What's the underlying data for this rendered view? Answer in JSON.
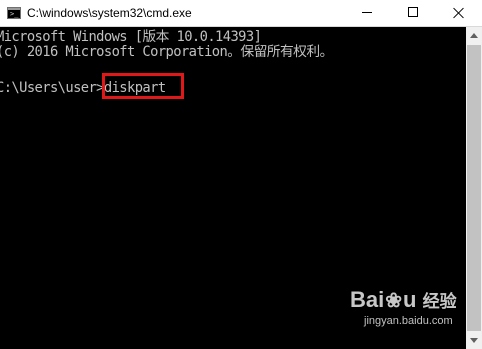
{
  "window": {
    "title": "C:\\windows\\system32\\cmd.exe",
    "buttons": {
      "minimize": "minimize-icon",
      "maximize": "maximize-icon",
      "close": "close-icon"
    }
  },
  "console": {
    "lines": [
      "Microsoft Windows [版本 10.0.14393]",
      "(c) 2016 Microsoft Corporation。保留所有权利。"
    ],
    "prompt": "C:\\Users\\user>",
    "command": "diskpart"
  },
  "highlight": {
    "color": "#e01818"
  },
  "watermark": {
    "logo_left": "Bai",
    "logo_right": "u",
    "logo_cn": "经验",
    "url": "jingyan.baidu.com"
  },
  "colors": {
    "console_bg": "#000000",
    "console_text": "#c0c0c0",
    "titlebar_bg": "#ffffff"
  }
}
